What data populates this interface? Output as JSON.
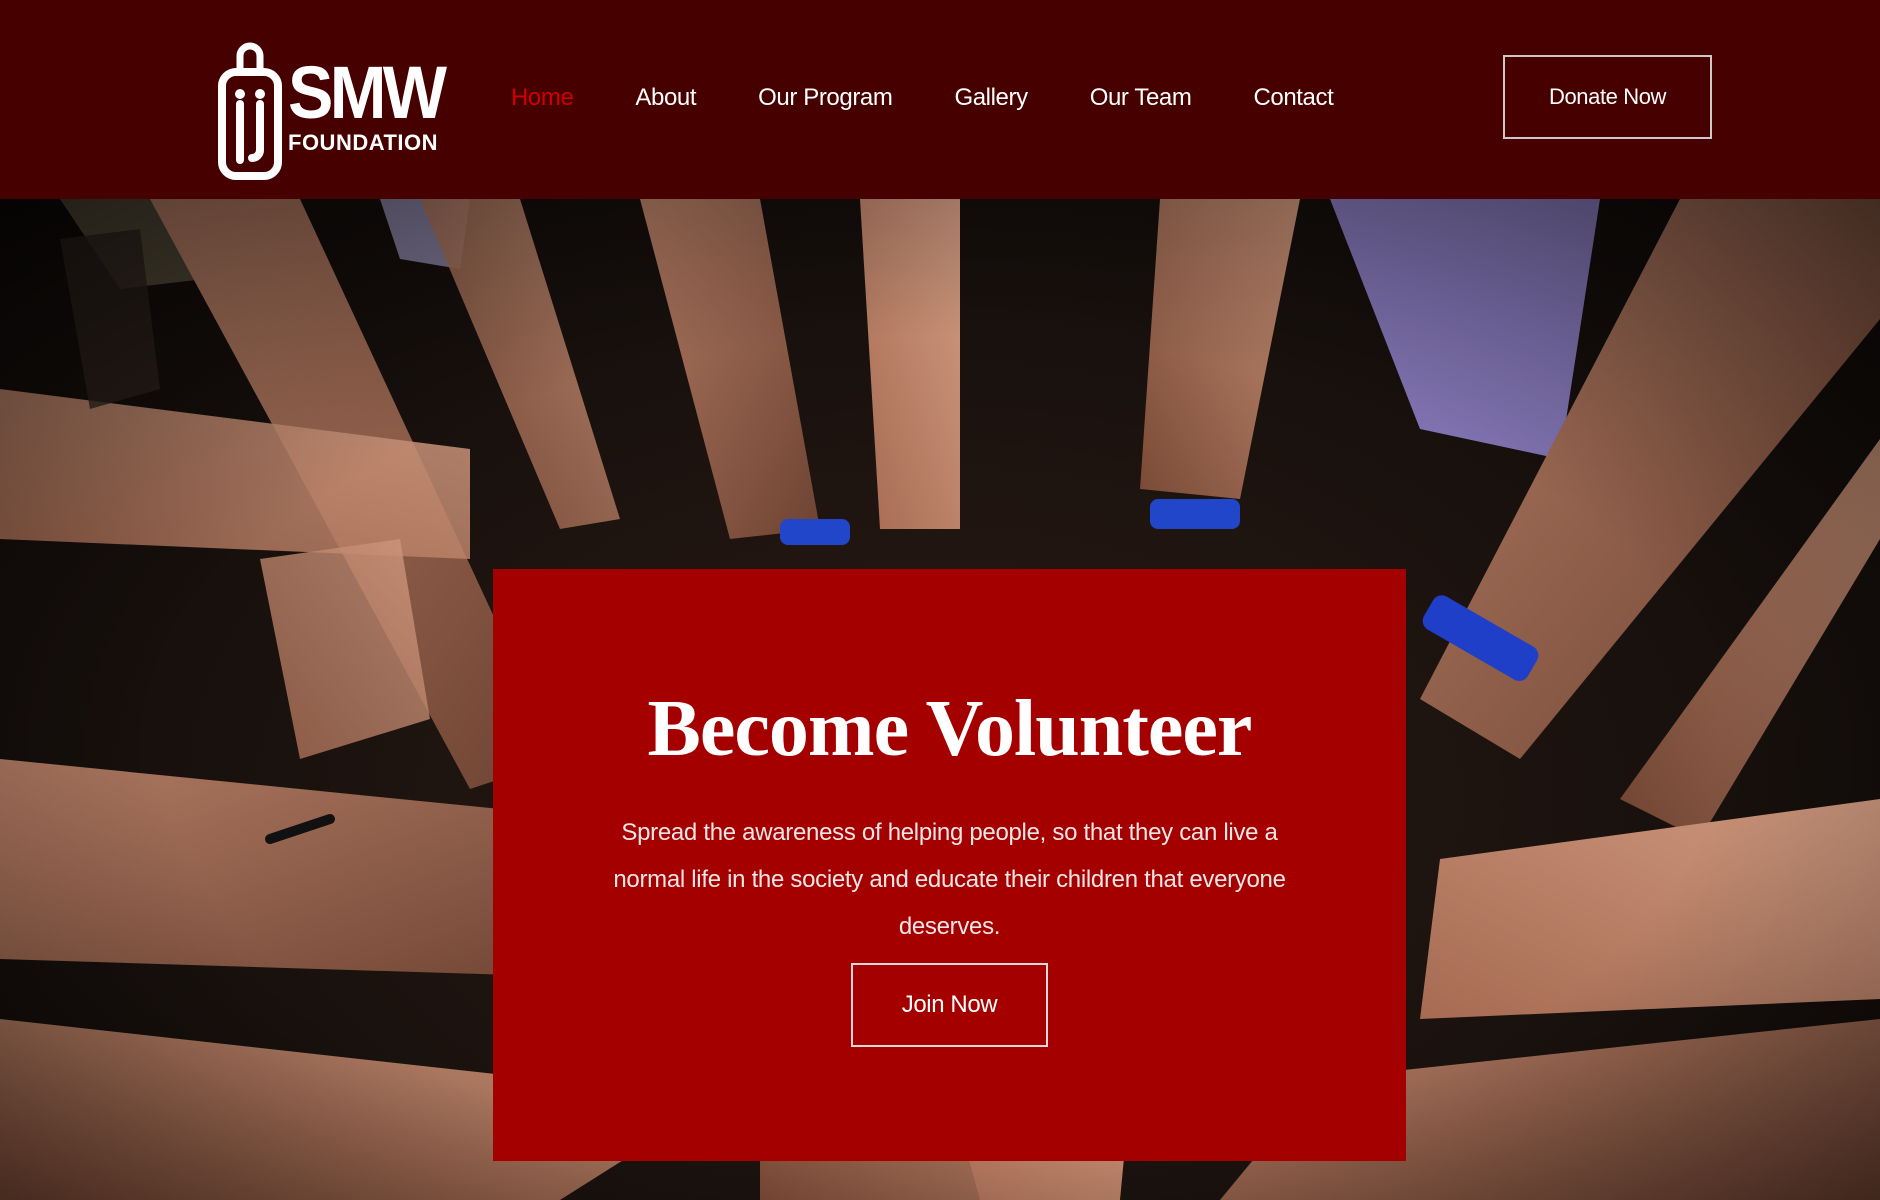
{
  "brand": {
    "name": "SMW",
    "subtitle": "FOUNDATION",
    "color": "#470000"
  },
  "nav": {
    "items": [
      {
        "label": "Home",
        "active": true
      },
      {
        "label": "About",
        "active": false
      },
      {
        "label": "Our Program",
        "active": false
      },
      {
        "label": "Gallery",
        "active": false
      },
      {
        "label": "Our Team",
        "active": false
      },
      {
        "label": "Contact",
        "active": false
      }
    ],
    "active_color": "#d00000"
  },
  "header": {
    "donate_label": "Donate Now"
  },
  "hero": {
    "title": "Become Volunteer",
    "text": "Spread the awareness of helping people, so that they can live a normal life in the society and educate their children that everyone deserves.",
    "cta_label": "Join Now",
    "card_color": "#a50000"
  }
}
